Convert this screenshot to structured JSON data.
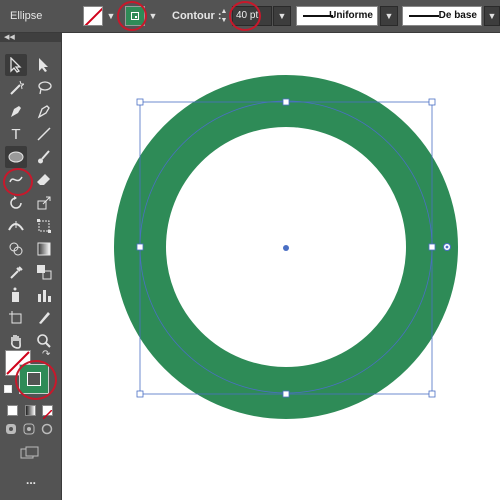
{
  "control_bar": {
    "object_type": "Ellipse",
    "fill_swatch": {
      "icon": "no-fill-swatch-icon"
    },
    "stroke_swatch": {
      "color": "#2e8b57",
      "icon": "stroke-swatch-icon"
    },
    "stroke_label": "Contour :",
    "stroke_weight": "40 pt",
    "variable_width_profile": "Uniforme",
    "brush_definition": "De base"
  },
  "toolbar": {
    "selected_tool": "ellipse-tool",
    "tools": [
      "selection-tool",
      "direct-selection-tool",
      "magic-wand-tool",
      "lasso-tool",
      "pen-tool",
      "curvature-tool",
      "type-tool",
      "line-segment-tool",
      "ellipse-tool",
      "paintbrush-tool",
      "shaper-tool",
      "eraser-tool",
      "rotate-tool",
      "scale-tool",
      "width-tool",
      "free-transform-tool",
      "shape-builder-tool",
      "gradient-tool",
      "eyedropper-tool",
      "blend-tool",
      "symbol-sprayer-tool",
      "column-graph-tool",
      "artboard-tool",
      "slice-tool",
      "hand-tool",
      "zoom-tool"
    ],
    "fill_stroke": {
      "fill": "none",
      "stroke": "#2e8b57"
    },
    "more_tools": "..."
  },
  "canvas": {
    "shape": "ellipse",
    "stroke_color": "#2e8b57",
    "fill": "none",
    "selection_color": "#4a6fc4"
  }
}
